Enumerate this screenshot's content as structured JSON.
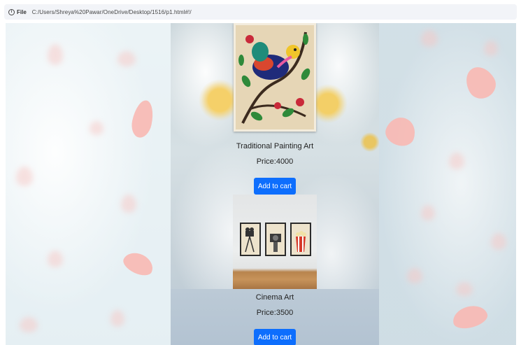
{
  "browser": {
    "scheme_label": "File",
    "url": "C:/Users/Shreya%20Pawar/OneDrive/Desktop/1516/p1.html#!/"
  },
  "products": [
    {
      "name": "Traditional Painting Art",
      "price": "Price:4000",
      "button_label": "Add to cart"
    },
    {
      "name": "Cinema Art",
      "price": "Price:3500",
      "button_label": "Add to cart"
    }
  ],
  "colors": {
    "button": "#0d6efd",
    "button_text": "#ffffff",
    "text": "#222222"
  },
  "icons": [
    "info-icon"
  ]
}
